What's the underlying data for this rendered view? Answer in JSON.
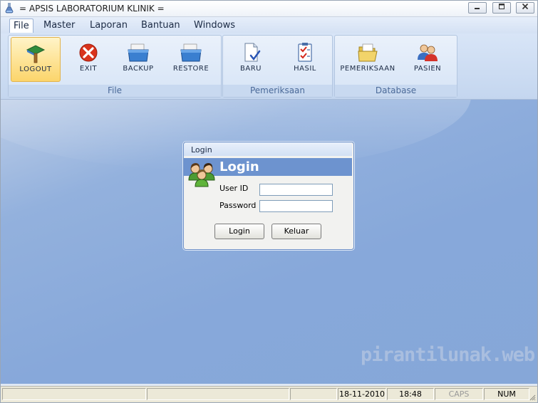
{
  "window": {
    "title": "= APSIS LABORATORIUM KLINIK ="
  },
  "menu": [
    {
      "label": "File",
      "active": true
    },
    {
      "label": "Master"
    },
    {
      "label": "Laporan"
    },
    {
      "label": "Bantuan"
    },
    {
      "label": "Windows"
    }
  ],
  "ribbon": {
    "groups": [
      {
        "label": "File",
        "buttons": [
          {
            "label": "LOGOUT",
            "icon": "logout-icon",
            "active": true
          },
          {
            "label": "EXIT",
            "icon": "exit-icon"
          },
          {
            "label": "BACKUP",
            "icon": "backup-icon"
          },
          {
            "label": "RESTORE",
            "icon": "restore-icon"
          }
        ]
      },
      {
        "label": "Pemeriksaan",
        "buttons": [
          {
            "label": "BARU",
            "icon": "new-document-icon"
          },
          {
            "label": "HASIL",
            "icon": "checklist-icon"
          }
        ]
      },
      {
        "label": "Database",
        "buttons": [
          {
            "label": "PEMERIKSAAN",
            "icon": "folder-icon"
          },
          {
            "label": "PASIEN",
            "icon": "patients-icon"
          }
        ]
      }
    ]
  },
  "login_dialog": {
    "title": "Login",
    "header": "Login",
    "userid_label": "User ID",
    "userid_value": "",
    "password_label": "Password",
    "password_value": "",
    "login_button": "Login",
    "cancel_button": "Keluar"
  },
  "watermark": "pirantilunak.web.id",
  "statusbar": {
    "date": "18-11-2010",
    "time": "18:48",
    "caps": "CAPS",
    "num": "NUM"
  },
  "colors": {
    "workspace": "#87a8da",
    "dialog_header": "#6d93cf",
    "ribbon_group_label": "#4b6a99",
    "active_button": "#fcd56b"
  }
}
